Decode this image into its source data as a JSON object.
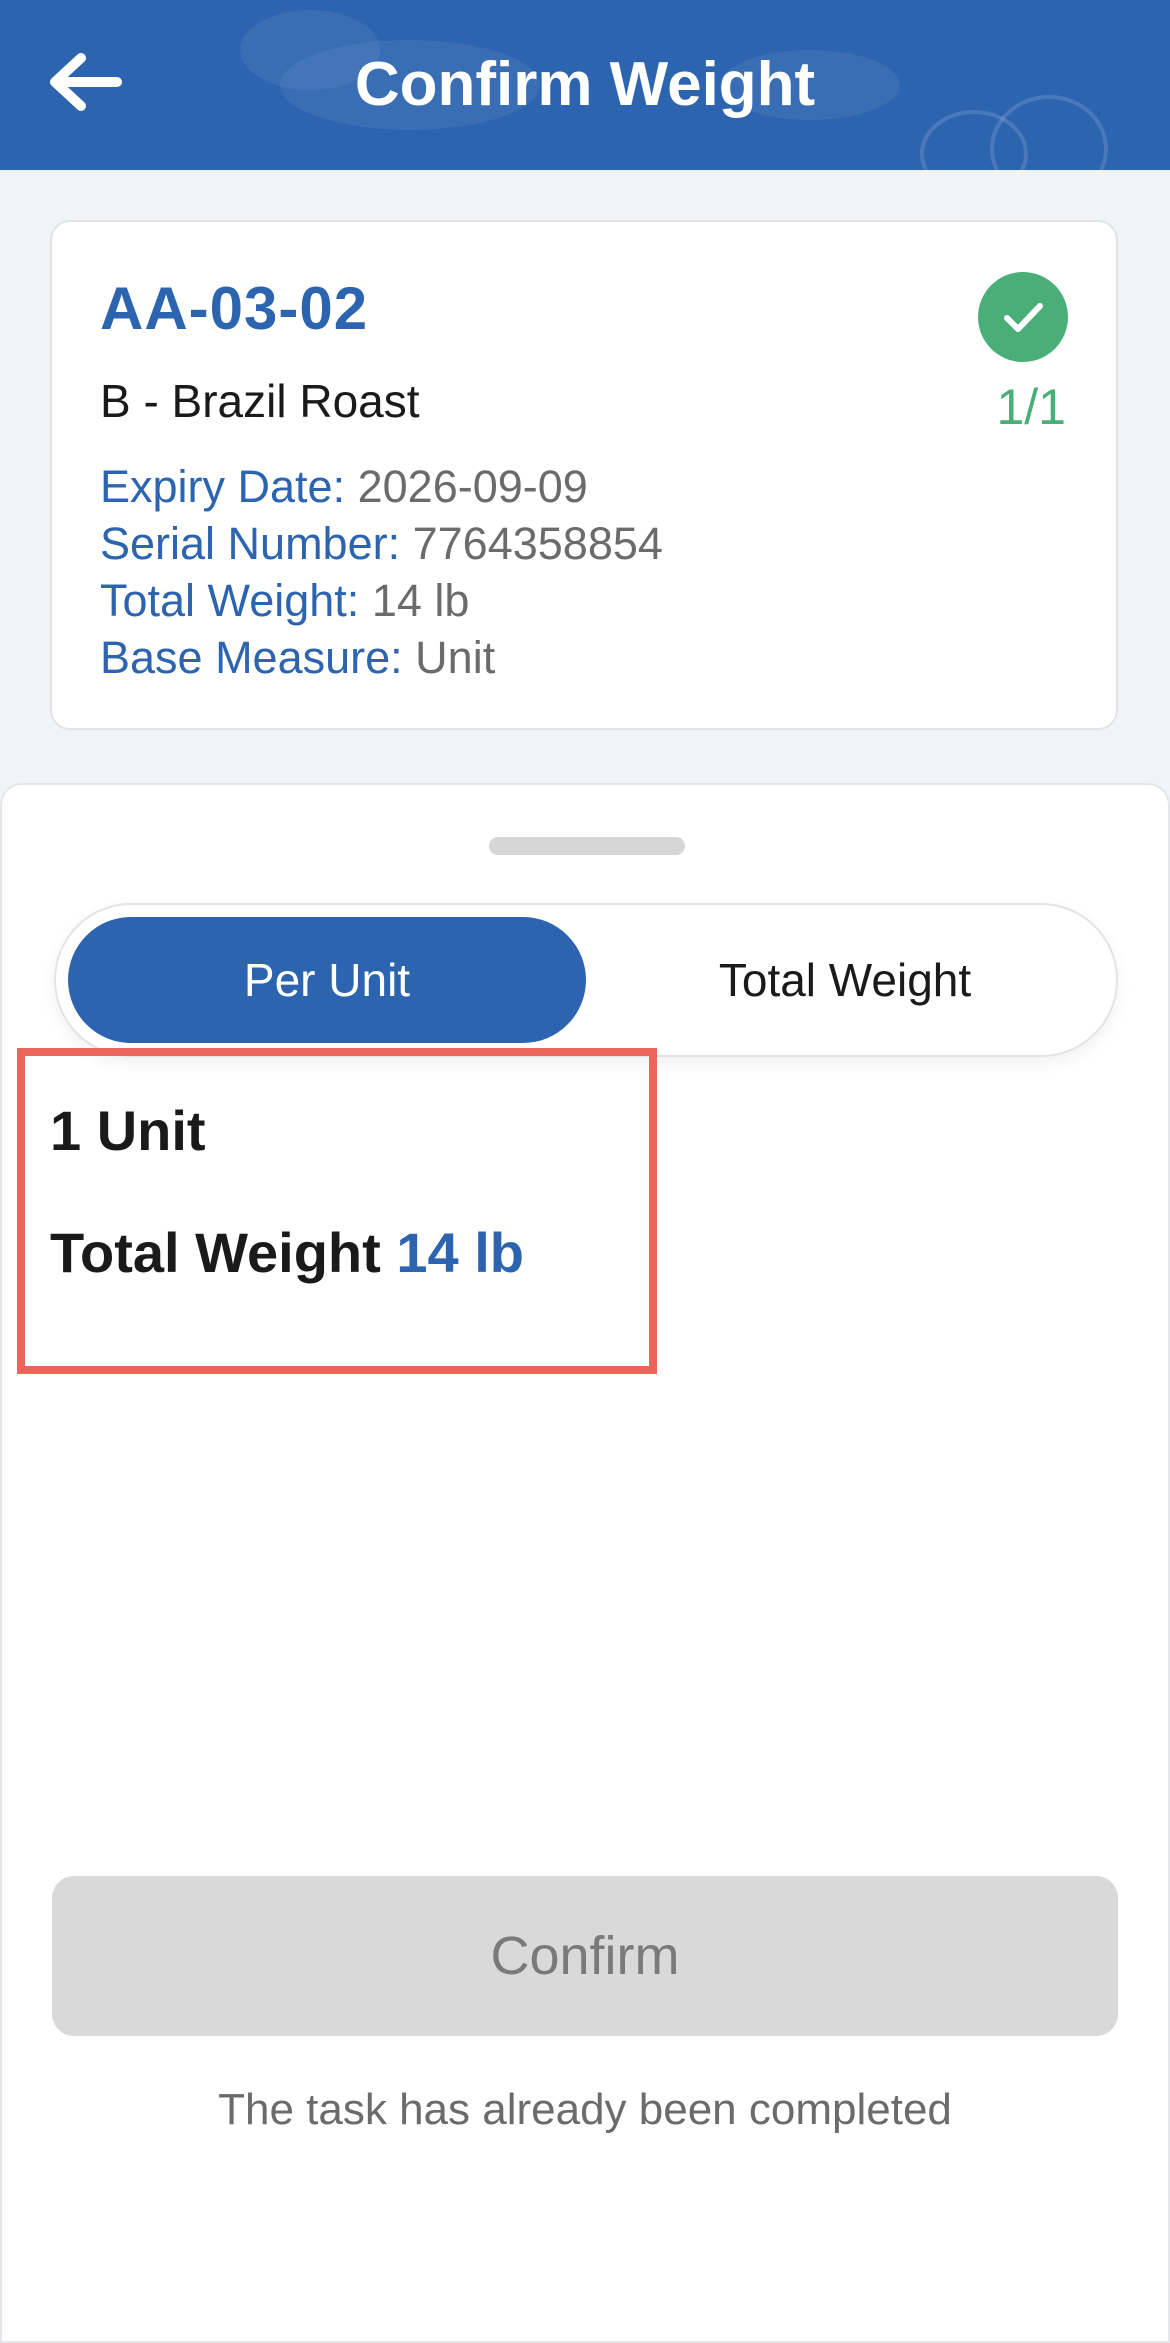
{
  "header": {
    "title": "Confirm Weight",
    "back_icon": "arrow-left-icon"
  },
  "item": {
    "location_code": "AA-03-02",
    "product_name": "B - Brazil Roast",
    "status_icon": "check-circle-icon",
    "progress": "1/1",
    "details": [
      {
        "label": "Expiry Date:",
        "value": "2026-09-09"
      },
      {
        "label": "Serial Number:",
        "value": "7764358854"
      },
      {
        "label": "Total Weight:",
        "value": "14 lb"
      },
      {
        "label": "Base Measure:",
        "value": "Unit"
      }
    ]
  },
  "mode_toggle": {
    "options": [
      "Per Unit",
      "Total Weight"
    ],
    "selected": "Per Unit"
  },
  "summary": {
    "unit_count": "1 Unit",
    "total_weight_label": "Total Weight",
    "total_weight_value": "14 lb"
  },
  "actions": {
    "confirm_label": "Confirm",
    "status_message": "The task has already been completed"
  },
  "colors": {
    "primary": "#2d64b0",
    "success": "#4aae79",
    "highlight": "#e8665a",
    "disabled": "#d9d9d9"
  }
}
